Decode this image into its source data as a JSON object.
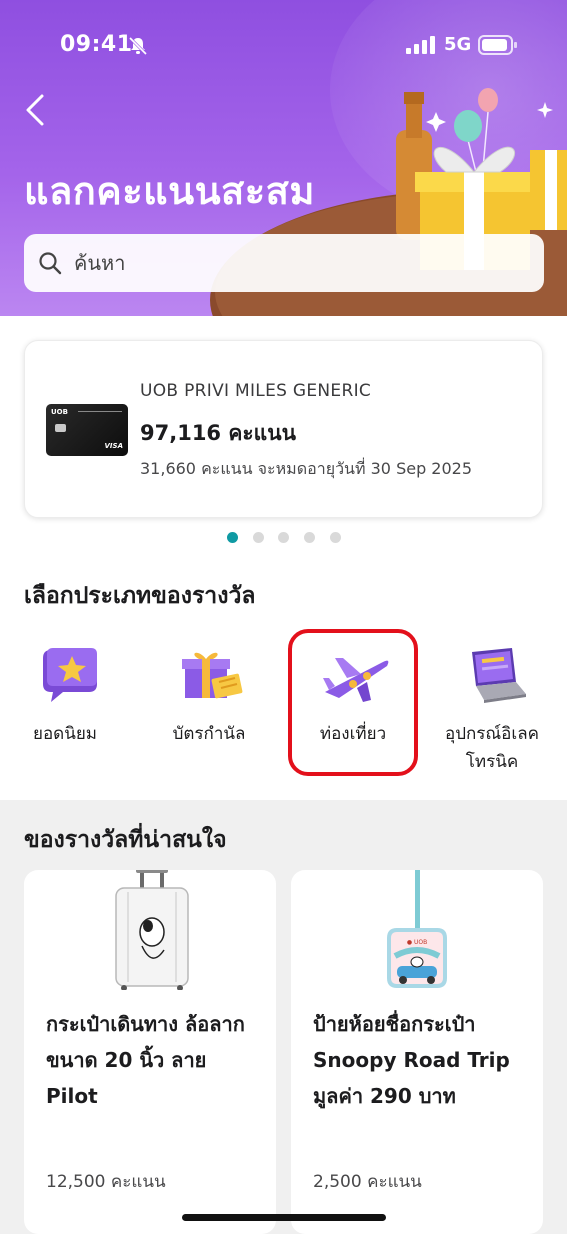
{
  "status_bar": {
    "time": "09:41",
    "network": "5G"
  },
  "header": {
    "title": "แลกคะแนนสะสม",
    "search_placeholder": "ค้นหา"
  },
  "card": {
    "name": "UOB PRIVI MILES GENERIC",
    "points": "97,116 คะแนน",
    "expiry": "31,660 คะแนน จะหมดอายุวันที่ 30 Sep 2025",
    "bank_label": "UOB",
    "network_label": "VISA",
    "pager_count": 5,
    "pager_active": 0
  },
  "categories": {
    "title": "เลือกประเภทของรางวัล",
    "items": [
      {
        "label": "ยอดนิยม",
        "icon": "star-badge-icon"
      },
      {
        "label": "บัตรกำนัล",
        "icon": "gift-voucher-icon"
      },
      {
        "label": "ท่องเที่ยว",
        "icon": "airplane-icon"
      },
      {
        "label": "อุปกรณ์อิเลค\nโทรนิค",
        "icon": "laptop-icon"
      }
    ]
  },
  "rewards": {
    "title": "ของรางวัลที่น่าสนใจ",
    "items": [
      {
        "title": "กระเป๋าเดินทาง ล้อลากขนาด 20 นิ้ว ลาย Pilot",
        "points": "12,500 คะแนน",
        "image": "suitcase-image"
      },
      {
        "title": "ป้ายห้อยชื่อกระเป๋า Snoopy Road Trip มูลค่า 290 บาท",
        "points": "2,500 คะแนน",
        "image": "luggage-tag-image"
      }
    ]
  },
  "colors": {
    "header": "#9b5be6",
    "accent_dot": "#0f9aa3",
    "highlight": "#e3101b"
  }
}
